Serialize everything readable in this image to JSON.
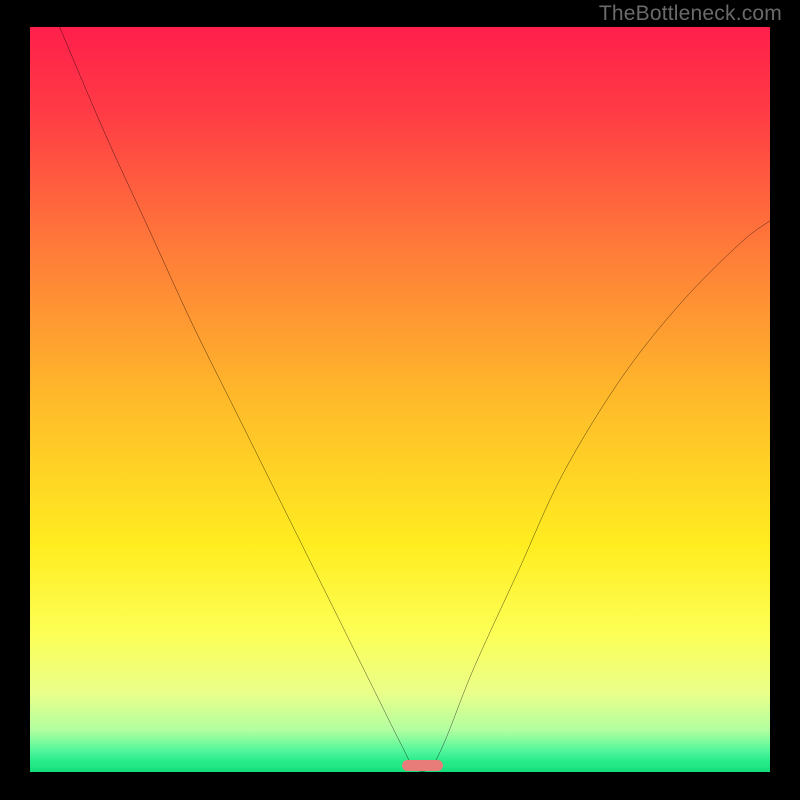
{
  "watermark": "TheBottleneck.com",
  "chart_data": {
    "type": "line",
    "title": "",
    "xlabel": "",
    "ylabel": "",
    "xlim": [
      0,
      100
    ],
    "ylim": [
      0,
      100
    ],
    "grid": false,
    "legend": false,
    "background": {
      "type": "vertical-gradient",
      "stops": [
        {
          "pct": 0,
          "color": "#ff1f4b"
        },
        {
          "pct": 12,
          "color": "#ff3d45"
        },
        {
          "pct": 30,
          "color": "#ff7b39"
        },
        {
          "pct": 50,
          "color": "#ffb92a"
        },
        {
          "pct": 70,
          "color": "#ffed20"
        },
        {
          "pct": 82,
          "color": "#fdff56"
        },
        {
          "pct": 90,
          "color": "#eaff8a"
        },
        {
          "pct": 95,
          "color": "#b2ffa0"
        },
        {
          "pct": 98,
          "color": "#4cf59a"
        },
        {
          "pct": 100,
          "color": "#11e47e"
        }
      ]
    },
    "series": [
      {
        "name": "bottleneck-curve",
        "color": "#000000",
        "points": [
          {
            "x": 4,
            "y": 100
          },
          {
            "x": 10,
            "y": 86
          },
          {
            "x": 16,
            "y": 73
          },
          {
            "x": 22,
            "y": 60
          },
          {
            "x": 28,
            "y": 48
          },
          {
            "x": 34,
            "y": 36
          },
          {
            "x": 40,
            "y": 24
          },
          {
            "x": 46,
            "y": 12
          },
          {
            "x": 50,
            "y": 4
          },
          {
            "x": 52,
            "y": 0.5
          },
          {
            "x": 54,
            "y": 0.5
          },
          {
            "x": 56,
            "y": 4
          },
          {
            "x": 60,
            "y": 14
          },
          {
            "x": 66,
            "y": 27
          },
          {
            "x": 72,
            "y": 40
          },
          {
            "x": 80,
            "y": 53
          },
          {
            "x": 88,
            "y": 63
          },
          {
            "x": 96,
            "y": 71
          },
          {
            "x": 100,
            "y": 74
          }
        ]
      }
    ],
    "marker": {
      "shape": "pill",
      "color": "#e77c78",
      "x_center": 53,
      "width_pct": 5.5,
      "y": 0.5
    }
  }
}
